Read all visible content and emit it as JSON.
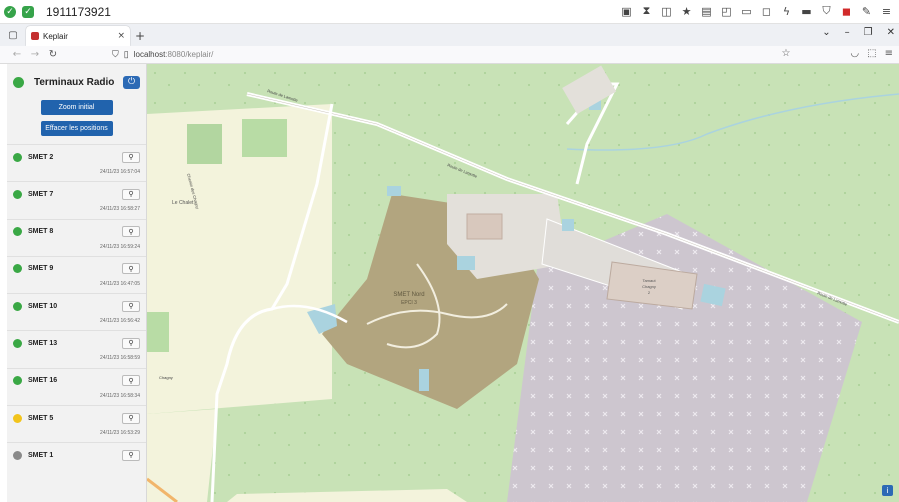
{
  "os_bar": {
    "title": "1911173921"
  },
  "browser": {
    "tab_title": "Keplair",
    "url_host": "localhost",
    "url_rest": ":8080/keplair/"
  },
  "sidebar": {
    "title": "Terminaux Radio",
    "zoom_button": "Zoom initial",
    "clear_button": "Effacer les positions",
    "terminals": [
      {
        "name": "SMET 2",
        "time": "24/11/23 16:57:04",
        "status_color": "#3aa845"
      },
      {
        "name": "SMET 7",
        "time": "24/11/23 16:58:27",
        "status_color": "#3aa845"
      },
      {
        "name": "SMET 8",
        "time": "24/11/23 16:59:24",
        "status_color": "#3aa845"
      },
      {
        "name": "SMET 9",
        "time": "24/11/23 16:47:05",
        "status_color": "#3aa845"
      },
      {
        "name": "SMET 10",
        "time": "24/11/23 16:56:42",
        "status_color": "#3aa845"
      },
      {
        "name": "SMET 13",
        "time": "24/11/23 16:58:59",
        "status_color": "#3aa845"
      },
      {
        "name": "SMET 16",
        "time": "24/11/23 16:58:34",
        "status_color": "#3aa845"
      },
      {
        "name": "SMET 5",
        "time": "24/11/23 16:53:29",
        "status_color": "#f2c41c"
      },
      {
        "name": "SMET 1",
        "time": "",
        "status_color": "#8a8a8a"
      }
    ]
  },
  "map": {
    "labels": {
      "route_north": "Route de Lamotte",
      "route_main": "Route de Lamotte",
      "route_east": "Route de Lamotte",
      "village": "Le Chalet",
      "site": "SMET Nord",
      "site_sub": "EPCI 3",
      "factory": "Tamaut",
      "factory_sub": "Chagny",
      "factory_num": "2",
      "chagny": "Chagny",
      "side_road": "Chemin des Chagny"
    },
    "info_label": "i"
  }
}
